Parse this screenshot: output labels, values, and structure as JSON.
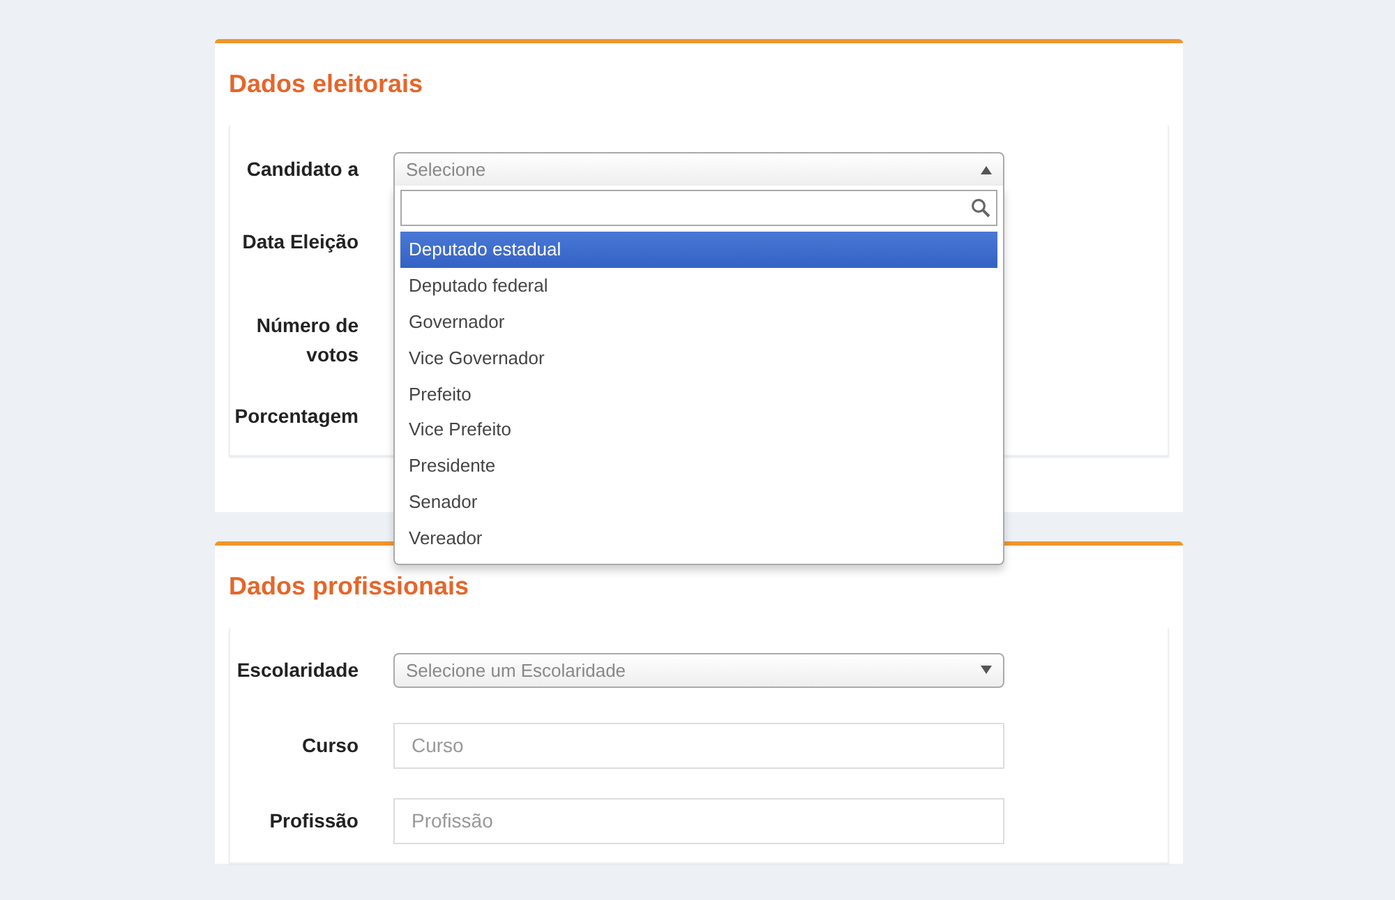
{
  "sections": [
    {
      "title": "Dados eleitorais",
      "fields": [
        {
          "label": "Candidato a",
          "kind": "dropdown",
          "placeholder": "Selecione",
          "open": true,
          "options": [
            {
              "label": "Deputado estadual",
              "selected": true
            },
            {
              "label": "Deputado federal",
              "selected": false
            },
            {
              "label": "Governador",
              "selected": false
            },
            {
              "label": "Vice Governador",
              "selected": false
            },
            {
              "label": "Prefeito",
              "selected": false
            },
            {
              "label": "Vice Prefeito",
              "selected": false
            },
            {
              "label": "Presidente",
              "selected": false
            },
            {
              "label": "Senador",
              "selected": false
            },
            {
              "label": "Vereador",
              "selected": false
            }
          ]
        },
        {
          "label": "Data Eleição",
          "kind": "hidden"
        },
        {
          "label": "Número de votos",
          "kind": "hidden"
        },
        {
          "label": "Porcentagem",
          "kind": "hidden"
        }
      ]
    },
    {
      "title": "Dados profissionais",
      "fields": [
        {
          "label": "Escolaridade",
          "kind": "dropdown",
          "placeholder": "Selecione um Escolaridade",
          "open": false
        },
        {
          "label": "Curso",
          "kind": "input",
          "placeholder": "Curso"
        },
        {
          "label": "Profissão",
          "kind": "input",
          "placeholder": "Profissão"
        }
      ]
    }
  ]
}
